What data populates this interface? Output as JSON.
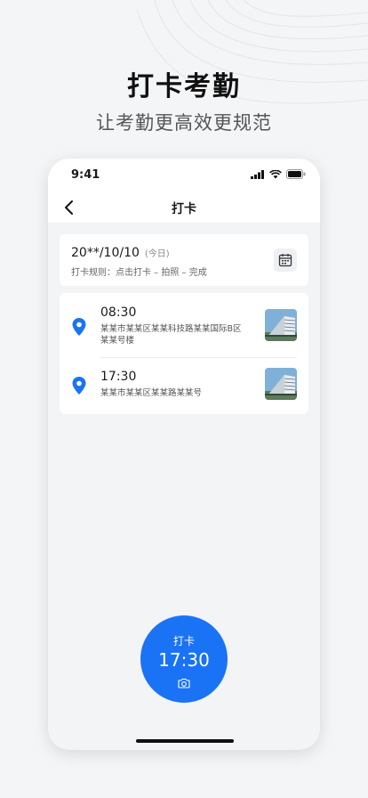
{
  "hero": {
    "title": "打卡考勤",
    "subtitle": "让考勤更高效更规范"
  },
  "status_bar": {
    "time": "9:41"
  },
  "nav": {
    "title": "打卡"
  },
  "date_card": {
    "date": "20**/10/10",
    "today": "(今日)",
    "rule": "打卡规则：点击打卡 – 拍照 – 完成"
  },
  "records": [
    {
      "time": "08:30",
      "address": "某某市某某区某某科技路某某国际B区某某号楼"
    },
    {
      "time": "17:30",
      "address": "某某市某某区某某路某某号"
    }
  ],
  "punch_button": {
    "label": "打卡",
    "time": "17:30"
  },
  "colors": {
    "accent": "#1a73f5",
    "background": "#f4f5f7"
  },
  "icons": [
    "back-arrow-icon",
    "calendar-icon",
    "location-pin-icon",
    "camera-icon",
    "signal-icon",
    "wifi-icon",
    "battery-icon"
  ]
}
